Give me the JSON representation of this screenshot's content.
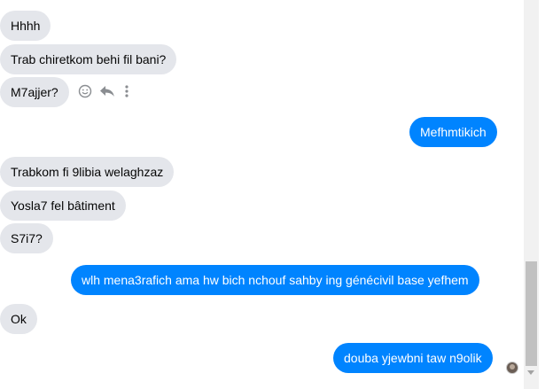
{
  "messages": [
    {
      "dir": "in",
      "text": "Hhhh"
    },
    {
      "dir": "in",
      "text": "Trab chiretkom behi fil bani?"
    },
    {
      "dir": "in",
      "text": "M7ajjer?"
    },
    {
      "dir": "out",
      "text": "Mefhmtikich"
    },
    {
      "dir": "in",
      "text": "Trabkom fi 9libia welaghzaz"
    },
    {
      "dir": "in",
      "text": "Yosla7 fel bâtiment"
    },
    {
      "dir": "in",
      "text": "S7i7?"
    },
    {
      "dir": "out",
      "text": "wlh mena3rafich ama hw bich nchouf sahby ing génécivil base yefhem"
    },
    {
      "dir": "in",
      "text": "Ok"
    },
    {
      "dir": "out",
      "text": "douba yjewbni taw n9olik"
    }
  ],
  "message_actions": [
    "emoji-react-icon",
    "reply-icon",
    "more-options-icon"
  ],
  "colors": {
    "incoming_bubble": "#e4e6eb",
    "outgoing_bubble": "#0084ff",
    "incoming_text": "#050505",
    "outgoing_text": "#ffffff"
  }
}
